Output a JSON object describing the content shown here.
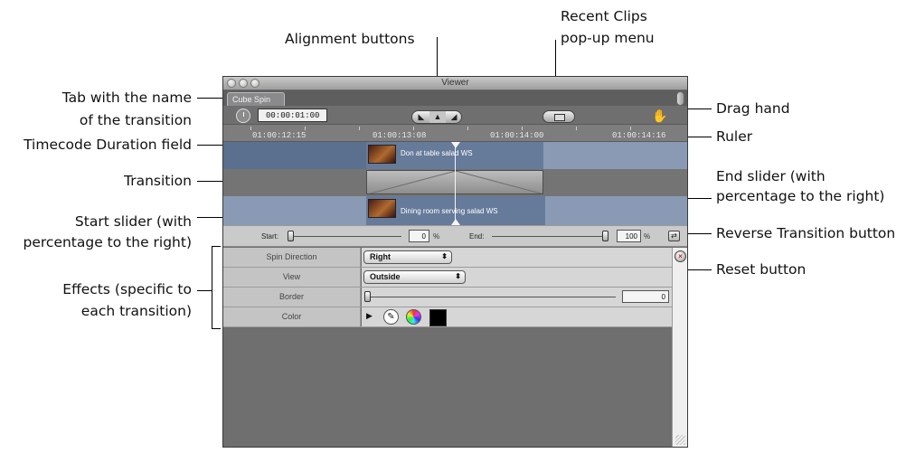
{
  "callouts": {
    "alignment_buttons": "Alignment buttons",
    "recent_clips_line1": "Recent Clips",
    "recent_clips_line2": "pop-up menu",
    "tab_name_line1": "Tab with the name",
    "tab_name_line2": "of the transition",
    "drag_hand": "Drag hand",
    "timecode_duration_field": "Timecode Duration field",
    "ruler": "Ruler",
    "transition": "Transition",
    "end_slider_line1": "End slider (with",
    "end_slider_line2": "percentage to the right)",
    "start_slider_line1": "Start slider (with",
    "start_slider_line2": "percentage to the right)",
    "reverse_transition_button": "Reverse Transition button",
    "reset_button": "Reset button",
    "effects_line1": "Effects (specific to",
    "effects_line2": "each transition)"
  },
  "window": {
    "title": "Viewer",
    "tab_label": "Cube Spin",
    "duration": "00:00:01:00",
    "alignment": {
      "left": "◣",
      "center": "▲",
      "right": "◢"
    },
    "ruler_labels": [
      "01:00:12:15",
      "01:00:13:08",
      "01:00:14:00",
      "01:00:14:16"
    ],
    "clip_a": "Don at table salad WS",
    "clip_b": "Dining room serving salad WS",
    "start_label": "Start:",
    "start_pct": "0",
    "end_label": "End:",
    "end_pct": "100",
    "pct_sign": "%",
    "reverse_btn_glyph": "⇄",
    "reset_glyph": "×",
    "params": [
      {
        "name": "Spin Direction",
        "value": "Right"
      },
      {
        "name": "View",
        "value": "Outside"
      },
      {
        "name": "Border",
        "value": "0"
      },
      {
        "name": "Color",
        "value": ""
      }
    ],
    "color_swatch": "#000000"
  }
}
